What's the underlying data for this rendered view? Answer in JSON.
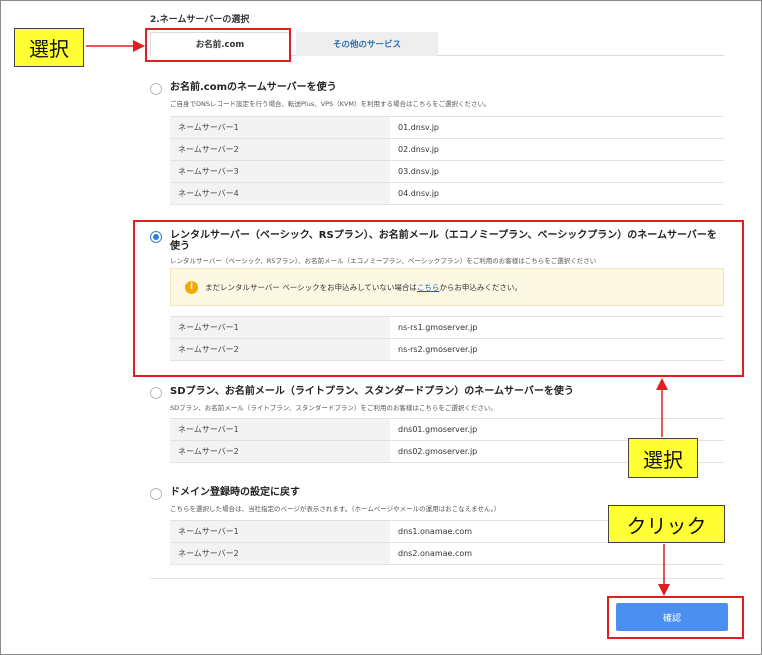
{
  "section_title": "2.ネームサーバーの選択",
  "tabs": [
    {
      "label": "お名前.com",
      "active": true
    },
    {
      "label": "その他のサービス",
      "active": false
    }
  ],
  "options": [
    {
      "title": "お名前.comのネームサーバーを使う",
      "desc": "ご自身でDNSレコード設定を行う場合、転送Plus、VPS（KVM）を利用する場合はこちらをご選択ください。",
      "checked": false,
      "rows": [
        {
          "k": "ネームサーバー1",
          "v": "01.dnsv.jp"
        },
        {
          "k": "ネームサーバー2",
          "v": "02.dnsv.jp"
        },
        {
          "k": "ネームサーバー3",
          "v": "03.dnsv.jp"
        },
        {
          "k": "ネームサーバー4",
          "v": "04.dnsv.jp"
        }
      ]
    },
    {
      "title": "レンタルサーバー（ベーシック、RSプラン）、お名前メール（エコノミープラン、ベーシックプラン）のネームサーバーを使う",
      "desc": "レンタルサーバー（ベーシック、RSプラン）、お名前メール（エコノミープラン、ベーシックプラン）をご利用のお客様はこちらをご選択ください",
      "checked": true,
      "notice": {
        "before": "まだレンタルサーバー ベーシックをお申込みしていない場合は",
        "link": "こちら",
        "after": "からお申込みください。"
      },
      "rows": [
        {
          "k": "ネームサーバー1",
          "v": "ns-rs1.gmoserver.jp"
        },
        {
          "k": "ネームサーバー2",
          "v": "ns-rs2.gmoserver.jp"
        }
      ]
    },
    {
      "title": "SDプラン、お名前メール（ライトプラン、スタンダードプラン）のネームサーバーを使う",
      "desc": "SDプラン、お名前メール（ライトプラン、スタンダードプラン）をご利用のお客様はこちらをご選択ください。",
      "checked": false,
      "rows": [
        {
          "k": "ネームサーバー1",
          "v": "dns01.gmoserver.jp"
        },
        {
          "k": "ネームサーバー2",
          "v": "dns02.gmoserver.jp"
        }
      ]
    },
    {
      "title": "ドメイン登録時の設定に戻す",
      "desc": "こちらを選択した場合は、当社指定のページが表示されます。（ホームページやメールの運用はおこなえません。）",
      "checked": false,
      "rows": [
        {
          "k": "ネームサーバー1",
          "v": "dns1.onamae.com"
        },
        {
          "k": "ネームサーバー2",
          "v": "dns2.onamae.com"
        }
      ]
    }
  ],
  "confirm_label": "確認",
  "callouts": {
    "select_tab": "選択",
    "select_option": "選択",
    "click": "クリック"
  },
  "colors": {
    "highlight": "#e02020",
    "callout_bg": "#ffff33",
    "primary": "#4a8ff0"
  }
}
